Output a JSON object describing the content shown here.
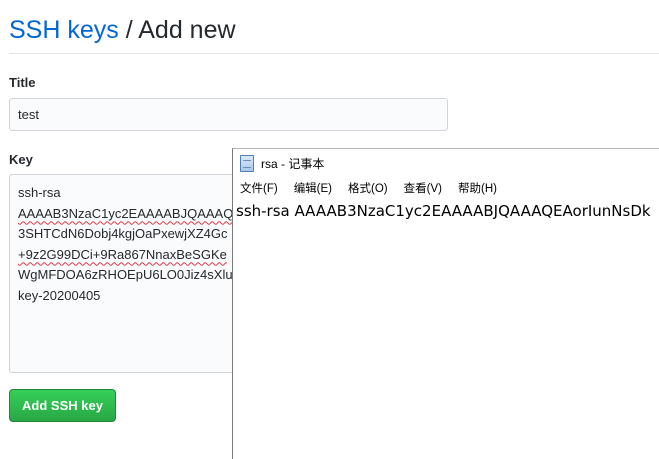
{
  "header": {
    "link_text": "SSH keys",
    "separator": "/",
    "current": "Add new"
  },
  "form": {
    "title_label": "Title",
    "title_value": "test",
    "key_label": "Key",
    "key_lines": [
      "ssh-rsa",
      "AAAAB3NzaC1yc2EAAAABJQAAAQ",
      "3SHTCdN6Dobj4kgjOaPxewjXZ4Gc",
      "+9z2G99DCi+9Ra867NnaxBeSGKe",
      "WgMFDOA6zRHOEpU6LO0Jiz4sXlu",
      "key-20200405"
    ],
    "submit_label": "Add SSH key"
  },
  "notepad": {
    "title": "rsa - 记事本",
    "menu": [
      "文件(F)",
      "编辑(E)",
      "格式(O)",
      "查看(V)",
      "帮助(H)"
    ],
    "content": "ssh-rsa AAAAB3NzaC1yc2EAAAABJQAAAQEAorIunNsDk"
  },
  "colors": {
    "link": "#0366d6",
    "button_green": "#28a745"
  }
}
